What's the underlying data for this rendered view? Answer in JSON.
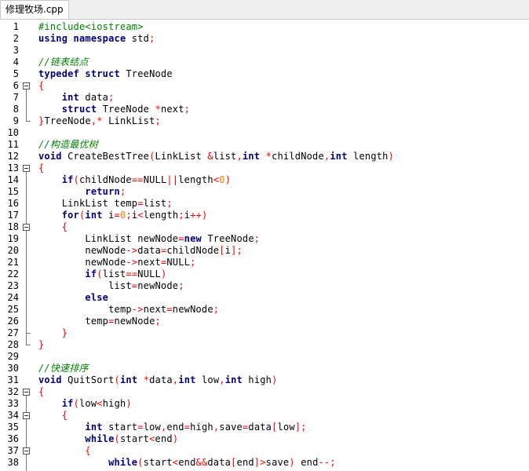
{
  "tab": {
    "label": "修理牧场.cpp"
  },
  "lines": [
    {
      "n": "1",
      "code": [
        [
          "pp",
          "#include<iostream>"
        ]
      ]
    },
    {
      "n": "2",
      "code": [
        [
          "kw",
          "using namespace"
        ],
        [
          "id",
          " std"
        ],
        [
          "op",
          ";"
        ]
      ]
    },
    {
      "n": "3",
      "code": []
    },
    {
      "n": "4",
      "code": [
        [
          "cm",
          "//链表结点"
        ]
      ]
    },
    {
      "n": "5",
      "code": [
        [
          "kw",
          "typedef struct"
        ],
        [
          "id",
          " TreeNode"
        ]
      ]
    },
    {
      "n": "6",
      "code": [
        [
          "op",
          "{"
        ]
      ]
    },
    {
      "n": "7",
      "code": [
        [
          "id",
          "    "
        ],
        [
          "kw",
          "int"
        ],
        [
          "id",
          " data"
        ],
        [
          "op",
          ";"
        ]
      ]
    },
    {
      "n": "8",
      "code": [
        [
          "id",
          "    "
        ],
        [
          "kw",
          "struct"
        ],
        [
          "id",
          " TreeNode "
        ],
        [
          "op",
          "*"
        ],
        [
          "id",
          "next"
        ],
        [
          "op",
          ";"
        ]
      ]
    },
    {
      "n": "9",
      "code": [
        [
          "op",
          "}"
        ],
        [
          "id",
          "TreeNode"
        ],
        [
          "op",
          ",*"
        ],
        [
          "id",
          " LinkList"
        ],
        [
          "op",
          ";"
        ]
      ]
    },
    {
      "n": "10",
      "code": []
    },
    {
      "n": "11",
      "code": [
        [
          "cm",
          "//构造最优树"
        ]
      ]
    },
    {
      "n": "12",
      "code": [
        [
          "kw",
          "void"
        ],
        [
          "id",
          " CreateBestTree"
        ],
        [
          "op",
          "("
        ],
        [
          "id",
          "LinkList "
        ],
        [
          "op",
          "&"
        ],
        [
          "id",
          "list"
        ],
        [
          "op",
          ","
        ],
        [
          "kw",
          "int"
        ],
        [
          "id",
          " "
        ],
        [
          "op",
          "*"
        ],
        [
          "id",
          "childNode"
        ],
        [
          "op",
          ","
        ],
        [
          "kw",
          "int"
        ],
        [
          "id",
          " length"
        ],
        [
          "op",
          ")"
        ]
      ]
    },
    {
      "n": "13",
      "code": [
        [
          "op",
          "{"
        ]
      ]
    },
    {
      "n": "14",
      "code": [
        [
          "id",
          "    "
        ],
        [
          "kw",
          "if"
        ],
        [
          "op",
          "("
        ],
        [
          "id",
          "childNode"
        ],
        [
          "op",
          "=="
        ],
        [
          "id",
          "NULL"
        ],
        [
          "op",
          "||"
        ],
        [
          "id",
          "length"
        ],
        [
          "op",
          "<"
        ],
        [
          "num",
          "0"
        ],
        [
          "op",
          ")"
        ]
      ]
    },
    {
      "n": "15",
      "code": [
        [
          "id",
          "        "
        ],
        [
          "kw",
          "return"
        ],
        [
          "op",
          ";"
        ]
      ]
    },
    {
      "n": "16",
      "code": [
        [
          "id",
          "    LinkList temp"
        ],
        [
          "op",
          "="
        ],
        [
          "id",
          "list"
        ],
        [
          "op",
          ";"
        ]
      ]
    },
    {
      "n": "17",
      "code": [
        [
          "id",
          "    "
        ],
        [
          "kw",
          "for"
        ],
        [
          "op",
          "("
        ],
        [
          "kw",
          "int"
        ],
        [
          "id",
          " i"
        ],
        [
          "op",
          "="
        ],
        [
          "num",
          "0"
        ],
        [
          "op",
          ";"
        ],
        [
          "id",
          "i"
        ],
        [
          "op",
          "<"
        ],
        [
          "id",
          "length"
        ],
        [
          "op",
          ";"
        ],
        [
          "id",
          "i"
        ],
        [
          "op",
          "++)"
        ]
      ]
    },
    {
      "n": "18",
      "code": [
        [
          "id",
          "    "
        ],
        [
          "op",
          "{"
        ]
      ]
    },
    {
      "n": "19",
      "code": [
        [
          "id",
          "        LinkList newNode"
        ],
        [
          "op",
          "="
        ],
        [
          "kw",
          "new"
        ],
        [
          "id",
          " TreeNode"
        ],
        [
          "op",
          ";"
        ]
      ]
    },
    {
      "n": "20",
      "code": [
        [
          "id",
          "        newNode"
        ],
        [
          "op",
          "->"
        ],
        [
          "id",
          "data"
        ],
        [
          "op",
          "="
        ],
        [
          "id",
          "childNode"
        ],
        [
          "op",
          "["
        ],
        [
          "id",
          "i"
        ],
        [
          "op",
          "];"
        ]
      ]
    },
    {
      "n": "21",
      "code": [
        [
          "id",
          "        newNode"
        ],
        [
          "op",
          "->"
        ],
        [
          "id",
          "next"
        ],
        [
          "op",
          "="
        ],
        [
          "id",
          "NULL"
        ],
        [
          "op",
          ";"
        ]
      ]
    },
    {
      "n": "22",
      "code": [
        [
          "id",
          "        "
        ],
        [
          "kw",
          "if"
        ],
        [
          "op",
          "("
        ],
        [
          "id",
          "list"
        ],
        [
          "op",
          "=="
        ],
        [
          "id",
          "NULL"
        ],
        [
          "op",
          ")"
        ]
      ]
    },
    {
      "n": "23",
      "code": [
        [
          "id",
          "            list"
        ],
        [
          "op",
          "="
        ],
        [
          "id",
          "newNode"
        ],
        [
          "op",
          ";"
        ]
      ]
    },
    {
      "n": "24",
      "code": [
        [
          "id",
          "        "
        ],
        [
          "kw",
          "else"
        ]
      ]
    },
    {
      "n": "25",
      "code": [
        [
          "id",
          "            temp"
        ],
        [
          "op",
          "->"
        ],
        [
          "id",
          "next"
        ],
        [
          "op",
          "="
        ],
        [
          "id",
          "newNode"
        ],
        [
          "op",
          ";"
        ]
      ]
    },
    {
      "n": "26",
      "code": [
        [
          "id",
          "        temp"
        ],
        [
          "op",
          "="
        ],
        [
          "id",
          "newNode"
        ],
        [
          "op",
          ";"
        ]
      ]
    },
    {
      "n": "27",
      "code": [
        [
          "id",
          "    "
        ],
        [
          "op",
          "}"
        ]
      ]
    },
    {
      "n": "28",
      "code": [
        [
          "op",
          "}"
        ]
      ]
    },
    {
      "n": "29",
      "code": []
    },
    {
      "n": "30",
      "code": [
        [
          "cm",
          "//快速排序"
        ]
      ]
    },
    {
      "n": "31",
      "code": [
        [
          "kw",
          "void"
        ],
        [
          "id",
          " QuitSort"
        ],
        [
          "op",
          "("
        ],
        [
          "kw",
          "int"
        ],
        [
          "id",
          " "
        ],
        [
          "op",
          "*"
        ],
        [
          "id",
          "data"
        ],
        [
          "op",
          ","
        ],
        [
          "kw",
          "int"
        ],
        [
          "id",
          " low"
        ],
        [
          "op",
          ","
        ],
        [
          "kw",
          "int"
        ],
        [
          "id",
          " high"
        ],
        [
          "op",
          ")"
        ]
      ]
    },
    {
      "n": "32",
      "code": [
        [
          "op",
          "{"
        ]
      ]
    },
    {
      "n": "33",
      "code": [
        [
          "id",
          "    "
        ],
        [
          "kw",
          "if"
        ],
        [
          "op",
          "("
        ],
        [
          "id",
          "low"
        ],
        [
          "op",
          "<"
        ],
        [
          "id",
          "high"
        ],
        [
          "op",
          ")"
        ]
      ]
    },
    {
      "n": "34",
      "code": [
        [
          "id",
          "    "
        ],
        [
          "op",
          "{"
        ]
      ]
    },
    {
      "n": "35",
      "code": [
        [
          "id",
          "        "
        ],
        [
          "kw",
          "int"
        ],
        [
          "id",
          " start"
        ],
        [
          "op",
          "="
        ],
        [
          "id",
          "low"
        ],
        [
          "op",
          ","
        ],
        [
          "id",
          "end"
        ],
        [
          "op",
          "="
        ],
        [
          "id",
          "high"
        ],
        [
          "op",
          ","
        ],
        [
          "id",
          "save"
        ],
        [
          "op",
          "="
        ],
        [
          "id",
          "data"
        ],
        [
          "op",
          "["
        ],
        [
          "id",
          "low"
        ],
        [
          "op",
          "];"
        ]
      ]
    },
    {
      "n": "36",
      "code": [
        [
          "id",
          "        "
        ],
        [
          "kw",
          "while"
        ],
        [
          "op",
          "("
        ],
        [
          "id",
          "start"
        ],
        [
          "op",
          "<"
        ],
        [
          "id",
          "end"
        ],
        [
          "op",
          ")"
        ]
      ]
    },
    {
      "n": "37",
      "code": [
        [
          "id",
          "        "
        ],
        [
          "op",
          "{"
        ]
      ]
    },
    {
      "n": "38",
      "code": [
        [
          "id",
          "            "
        ],
        [
          "kw",
          "while"
        ],
        [
          "op",
          "("
        ],
        [
          "id",
          "start"
        ],
        [
          "op",
          "<"
        ],
        [
          "id",
          "end"
        ],
        [
          "op",
          "&&"
        ],
        [
          "id",
          "data"
        ],
        [
          "op",
          "["
        ],
        [
          "id",
          "end"
        ],
        [
          "op",
          "]>"
        ],
        [
          "id",
          "save"
        ],
        [
          "op",
          ")"
        ],
        [
          "id",
          " end"
        ],
        [
          "op",
          "--;"
        ]
      ]
    }
  ],
  "folds": [
    {
      "line": 6,
      "icon": "fold-minus-icon"
    },
    {
      "line": 13,
      "icon": "fold-minus-icon"
    },
    {
      "line": 18,
      "icon": "fold-minus-icon"
    },
    {
      "line": 32,
      "icon": "fold-minus-icon"
    },
    {
      "line": 34,
      "icon": "fold-minus-icon"
    },
    {
      "line": 37,
      "icon": "fold-minus-icon"
    }
  ],
  "colors": {
    "keyword": "#000080",
    "comment": "#008000",
    "operator": "#ff0000",
    "number": "#ff8000"
  }
}
